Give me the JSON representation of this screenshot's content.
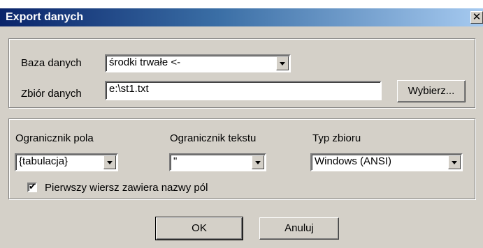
{
  "window": {
    "title": "Export danych",
    "close_glyph": "✕"
  },
  "source": {
    "database_label": "Baza danych",
    "database_value": "środki trwałe <-",
    "file_label": "Zbiór danych",
    "file_value": "e:\\st1.txt",
    "browse_label": "Wybierz..."
  },
  "options": {
    "field_delim_label": "Ogranicznik pola",
    "field_delim_value": "{tabulacja}",
    "text_delim_label": "Ogranicznik tekstu",
    "text_delim_value": "\"",
    "file_type_label": "Typ zbioru",
    "file_type_value": "Windows (ANSI)",
    "header_checkbox_label": "Pierwszy wiersz zawiera nazwy pól",
    "header_checkbox_checked": true
  },
  "buttons": {
    "ok": "OK",
    "cancel": "Anuluj"
  },
  "icons": {
    "close": "close-icon",
    "dropdown": "chevron-down-icon",
    "check": "check-icon"
  },
  "colors": {
    "titlebar_start": "#0a246a",
    "titlebar_end": "#a6caf0",
    "face": "#d4d0c8"
  }
}
